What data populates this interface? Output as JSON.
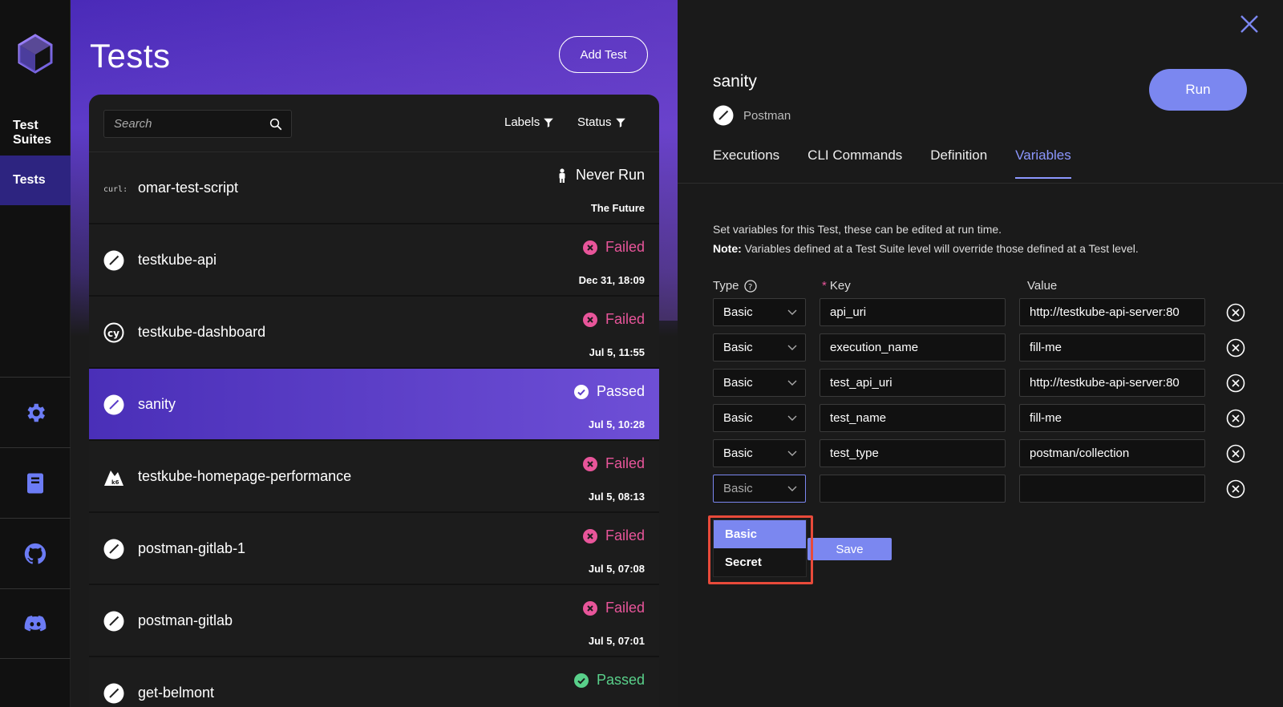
{
  "nav": {
    "items": [
      {
        "label": "Test Suites"
      },
      {
        "label": "Tests"
      }
    ],
    "bottom_icons": [
      "gear-icon",
      "book-icon",
      "github-icon",
      "discord-icon"
    ],
    "accent": "#6c7cf5"
  },
  "list": {
    "title": "Tests",
    "add_button": "Add Test",
    "search_placeholder": "Search",
    "filters": [
      "Labels",
      "Status"
    ],
    "rows": [
      {
        "name": "omar-test-script",
        "status": "Never Run",
        "when": "The Future",
        "icon": "curl-icon"
      },
      {
        "name": "testkube-api",
        "status": "Failed",
        "when": "Dec 31, 18:09",
        "icon": "postman-icon"
      },
      {
        "name": "testkube-dashboard",
        "status": "Failed",
        "when": "Jul 5, 11:55",
        "icon": "cypress-icon"
      },
      {
        "name": "sanity",
        "status": "Passed",
        "when": "Jul 5, 10:28",
        "icon": "postman-icon"
      },
      {
        "name": "testkube-homepage-performance",
        "status": "Failed",
        "when": "Jul 5, 08:13",
        "icon": "k6-icon"
      },
      {
        "name": "postman-gitlab-1",
        "status": "Failed",
        "when": "Jul 5, 07:08",
        "icon": "postman-icon"
      },
      {
        "name": "postman-gitlab",
        "status": "Failed",
        "when": "Jul 5, 07:01",
        "icon": "postman-icon"
      },
      {
        "name": "get-belmont",
        "status": "Passed",
        "when": "",
        "icon": "postman-icon"
      }
    ],
    "colors": {
      "failed": "#e8559a",
      "passed": "#59d08a",
      "selected": "#5b3dc9"
    }
  },
  "detail": {
    "title": "sanity",
    "type": "Postman",
    "run_button": "Run",
    "tabs": [
      "Executions",
      "CLI Commands",
      "Definition",
      "Variables"
    ],
    "active_tab": "Variables",
    "desc_line1": "Set variables for this Test, these can be edited at run time.",
    "note_label": "Note:",
    "note_text": " Variables defined at a Test Suite level will override those defined at a Test level.",
    "col_type": "Type",
    "col_key_ast": "*",
    "col_key": "Key",
    "col_value": "Value",
    "variables": [
      {
        "type": "Basic",
        "key": "api_uri",
        "value": "http://testkube-api-server:80"
      },
      {
        "type": "Basic",
        "key": "execution_name",
        "value": "fill-me"
      },
      {
        "type": "Basic",
        "key": "test_api_uri",
        "value": "http://testkube-api-server:80"
      },
      {
        "type": "Basic",
        "key": "test_name",
        "value": "fill-me"
      },
      {
        "type": "Basic",
        "key": "test_type",
        "value": "postman/collection"
      },
      {
        "type": "Basic",
        "key": "",
        "value": ""
      }
    ],
    "dropdown_options": [
      "Basic",
      "Secret"
    ],
    "save_button": "Save"
  }
}
